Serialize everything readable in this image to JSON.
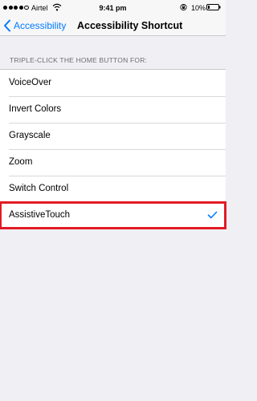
{
  "status_bar": {
    "carrier": "Airtel",
    "time": "9:41 pm",
    "battery": "10%"
  },
  "nav": {
    "back_label": "Accessibility",
    "title": "Accessibility Shortcut"
  },
  "section_header": "TRIPLE-CLICK THE HOME BUTTON FOR:",
  "options": [
    {
      "label": "VoiceOver",
      "checked": false
    },
    {
      "label": "Invert Colors",
      "checked": false
    },
    {
      "label": "Grayscale",
      "checked": false
    },
    {
      "label": "Zoom",
      "checked": false
    },
    {
      "label": "Switch Control",
      "checked": false
    },
    {
      "label": "AssistiveTouch",
      "checked": true
    }
  ],
  "colors": {
    "accent": "#007aff",
    "highlight": "#e21b24",
    "background": "#efeff4"
  }
}
